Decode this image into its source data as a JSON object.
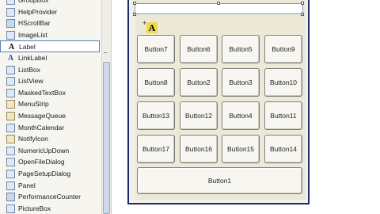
{
  "toolbox": {
    "items": [
      {
        "label": "GroupBox",
        "icon": "groupbox-icon"
      },
      {
        "label": "HelpProvider",
        "icon": "helpprovider-icon"
      },
      {
        "label": "HScrollBar",
        "icon": "hscrollbar-icon"
      },
      {
        "label": "ImageList",
        "icon": "imagelist-icon"
      },
      {
        "label": "Label",
        "icon": "label-icon"
      },
      {
        "label": "LinkLabel",
        "icon": "linklabel-icon"
      },
      {
        "label": "ListBox",
        "icon": "listbox-icon"
      },
      {
        "label": "ListView",
        "icon": "listview-icon"
      },
      {
        "label": "MaskedTextBox",
        "icon": "maskedtextbox-icon"
      },
      {
        "label": "MenuStrip",
        "icon": "menustrip-icon"
      },
      {
        "label": "MessageQueue",
        "icon": "messagequeue-icon"
      },
      {
        "label": "MonthCalendar",
        "icon": "monthcalendar-icon"
      },
      {
        "label": "NotifyIcon",
        "icon": "notifyicon-icon"
      },
      {
        "label": "NumericUpDown",
        "icon": "numericupdown-icon"
      },
      {
        "label": "OpenFileDialog",
        "icon": "openfiledialog-icon"
      },
      {
        "label": "PageSetupDialog",
        "icon": "pagesetupdialog-icon"
      },
      {
        "label": "Panel",
        "icon": "panel-icon"
      },
      {
        "label": "PerformanceCounter",
        "icon": "performancecounter-icon"
      },
      {
        "label": "PictureBox",
        "icon": "picturebox-icon"
      }
    ],
    "selected": "Label"
  },
  "form": {
    "buttons": [
      [
        "Button7",
        "Button6",
        "Button5",
        "Button9"
      ],
      [
        "Button8",
        "Button2",
        "Button3",
        "Button10"
      ],
      [
        "Button13",
        "Button12",
        "Button4",
        "Button11"
      ],
      [
        "Button17",
        "Button16",
        "Button15",
        "Button14"
      ]
    ],
    "wide_button": "Button1",
    "label_glyph": "A"
  }
}
